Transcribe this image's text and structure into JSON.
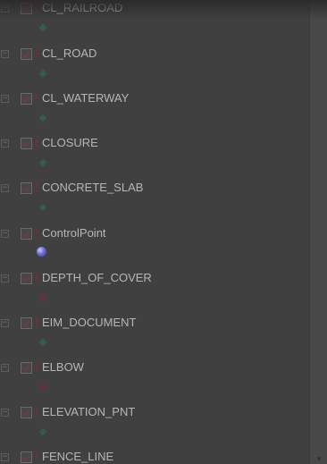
{
  "tree": {
    "layers": [
      {
        "label": "CL_RAILROAD",
        "symbol": "point-diamond-icon",
        "symbol_color": "#2f5f4f"
      },
      {
        "label": "CL_ROAD",
        "symbol": "point-diamond-icon",
        "symbol_color": "#2f5f4f"
      },
      {
        "label": "CL_WATERWAY",
        "symbol": "point-diamond-icon",
        "symbol_color": "#2f5f4f"
      },
      {
        "label": "CLOSURE",
        "symbol": "point-diamond-icon",
        "symbol_color": "#2f5f4f"
      },
      {
        "label": "CONCRETE_SLAB",
        "symbol": "point-diamond-icon",
        "symbol_color": "#2f5f4f"
      },
      {
        "label": "ControlPoint",
        "symbol": "globe-icon",
        "symbol_color": "#5a5ad0"
      },
      {
        "label": "DEPTH_OF_COVER",
        "symbol": "point-diamond-icon",
        "symbol_color": "#6a2f3a"
      },
      {
        "label": "EIM_DOCUMENT",
        "symbol": "point-diamond-icon",
        "symbol_color": "#2f5f4f"
      },
      {
        "label": "ELBOW",
        "symbol": "point-diamond-icon",
        "symbol_color": "#6a2f3a"
      },
      {
        "label": "ELEVATION_PNT",
        "symbol": "point-diamond-icon",
        "symbol_color": "#2f5f4f"
      },
      {
        "label": "FENCE_LINE",
        "symbol": "point-diamond-icon",
        "symbol_color": "#2f5f4f"
      }
    ],
    "toggle_glyph": "−",
    "warning_glyph": "!"
  }
}
